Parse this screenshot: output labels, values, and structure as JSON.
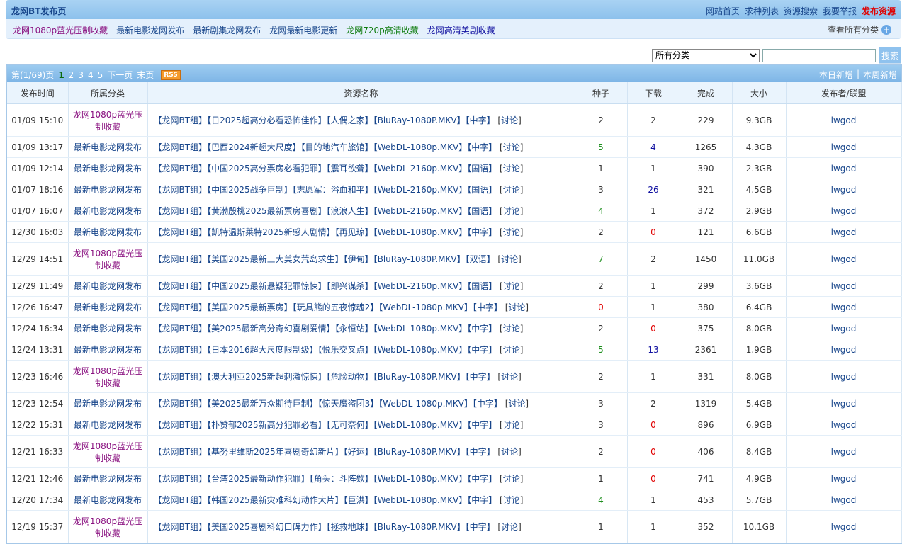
{
  "header": {
    "site_title": "龙网BT发布页",
    "nav": [
      {
        "label": "网站首页"
      },
      {
        "label": "求种列表"
      },
      {
        "label": "资源搜索"
      },
      {
        "label": "我要举报"
      },
      {
        "label": "发布资源"
      }
    ]
  },
  "categories": {
    "links": [
      {
        "label": "龙网1080p蓝光压制收藏",
        "color": "#8a1180"
      },
      {
        "label": "最新电影龙网发布",
        "color": "#16448a"
      },
      {
        "label": "最新剧集龙网发布",
        "color": "#16448a"
      },
      {
        "label": "龙网最新电影更新",
        "color": "#16448a"
      },
      {
        "label": "龙网720p高清收藏",
        "color": "#0b7a0b"
      },
      {
        "label": "龙网高清美剧收藏",
        "color": "#1010a0"
      }
    ],
    "view_all_label": "查看所有分类"
  },
  "search": {
    "select_value": "所有分类",
    "input_value": "",
    "button_label": "搜索"
  },
  "pager": {
    "info": "第(1/69)页",
    "current": "1",
    "pages": [
      "2",
      "3",
      "4",
      "5"
    ],
    "next": "下一页",
    "last": "末页",
    "rss": "RSS",
    "today": "本日新增",
    "separator": "|",
    "week": "本周新增"
  },
  "table": {
    "headers": [
      "发布时间",
      "所属分类",
      "资源名称",
      "种子",
      "下载",
      "完成",
      "大小",
      "发布者/联盟"
    ],
    "discuss_label": "讨论",
    "rows": [
      {
        "time": "01/09 15:10",
        "cat": "龙网1080p蓝光压制收藏",
        "title": "【龙网BT组】【日2025超高分必看恐怖佳作】【人偶之家】【BluRay-1080P.MKV】【中字】",
        "seeds": "2",
        "dl": "2",
        "done": "229",
        "size": "9.3GB",
        "pub": "lwgod"
      },
      {
        "time": "01/09 13:17",
        "cat": "最新电影龙网发布",
        "title": "【龙网BT组】【巴西2024新超大尺度】【目的地汽车旅馆】【WebDL-1080p.MKV】【中字】",
        "seeds": "5",
        "dl": "4",
        "done": "1265",
        "size": "4.3GB",
        "pub": "lwgod"
      },
      {
        "time": "01/09 12:14",
        "cat": "最新电影龙网发布",
        "title": "【龙网BT组】【中国2025高分票房必看犯罪】【震耳欲聋】【WebDL-2160p.MKV】【国语】",
        "seeds": "1",
        "dl": "1",
        "done": "390",
        "size": "2.3GB",
        "pub": "lwgod"
      },
      {
        "time": "01/07 18:16",
        "cat": "最新电影龙网发布",
        "title": "【龙网BT组】【中国2025战争巨制】【志愿军：浴血和平】【WebDL-2160p.MKV】【国语】",
        "seeds": "3",
        "dl": "26",
        "done": "321",
        "size": "4.5GB",
        "pub": "lwgod"
      },
      {
        "time": "01/07 16:07",
        "cat": "最新电影龙网发布",
        "title": "【龙网BT组】【黄渤殷桃2025最新票房喜剧】【浪浪人生】【WebDL-2160p.MKV】【国语】",
        "seeds": "4",
        "dl": "1",
        "done": "372",
        "size": "2.9GB",
        "pub": "lwgod"
      },
      {
        "time": "12/30 16:03",
        "cat": "最新电影龙网发布",
        "title": "【龙网BT组】【凯特温斯莱特2025新感人剧情】【再见琼】【WebDL-1080p.MKV】【中字】",
        "seeds": "2",
        "dl": "0",
        "done": "121",
        "size": "6.6GB",
        "pub": "lwgod"
      },
      {
        "time": "12/29 14:51",
        "cat": "龙网1080p蓝光压制收藏",
        "title": "【龙网BT组】【美国2025最新三大美女荒岛求生】【伊甸】【BluRay-1080P.MKV】【双语】",
        "seeds": "7",
        "dl": "2",
        "done": "1450",
        "size": "11.0GB",
        "pub": "lwgod"
      },
      {
        "time": "12/29 11:49",
        "cat": "最新电影龙网发布",
        "title": "【龙网BT组】【中国2025最新悬疑犯罪惊悚】【即兴谋杀】【WebDL-2160p.MKV】【国语】",
        "seeds": "2",
        "dl": "1",
        "done": "299",
        "size": "3.6GB",
        "pub": "lwgod"
      },
      {
        "time": "12/26 16:47",
        "cat": "最新电影龙网发布",
        "title": "【龙网BT组】【美国2025最新票房】【玩具熊的五夜惊魂2】【WebDL-1080p.MKV】【中字】",
        "seeds": "0",
        "dl": "1",
        "done": "380",
        "size": "6.4GB",
        "pub": "lwgod"
      },
      {
        "time": "12/24 16:34",
        "cat": "最新电影龙网发布",
        "title": "【龙网BT组】【美2025最新高分奇幻喜剧爱情】【永恒站】【WebDL-1080p.MKV】【中字】",
        "seeds": "2",
        "dl": "0",
        "done": "375",
        "size": "8.0GB",
        "pub": "lwgod"
      },
      {
        "time": "12/24 13:31",
        "cat": "最新电影龙网发布",
        "title": "【龙网BT组】【日本2016超大尺度限制级】【悦乐交叉点】【WebDL-1080p.MKV】【中字】",
        "seeds": "5",
        "dl": "13",
        "done": "2361",
        "size": "1.9GB",
        "pub": "lwgod"
      },
      {
        "time": "12/23 16:46",
        "cat": "龙网1080p蓝光压制收藏",
        "title": "【龙网BT组】【澳大利亚2025新超刺激惊悚】【危险动物】【BluRay-1080P.MKV】【中字】",
        "seeds": "2",
        "dl": "1",
        "done": "331",
        "size": "8.0GB",
        "pub": "lwgod"
      },
      {
        "time": "12/23 12:54",
        "cat": "最新电影龙网发布",
        "title": "【龙网BT组】【美2025最新万众期待巨制】【惊天魔盗团3】【WebDL-1080p.MKV】【中字】",
        "seeds": "3",
        "dl": "2",
        "done": "1319",
        "size": "5.4GB",
        "pub": "lwgod"
      },
      {
        "time": "12/22 15:31",
        "cat": "最新电影龙网发布",
        "title": "【龙网BT组】【朴赞郁2025新高分犯罪必看】【无可奈何】【WebDL-1080p.MKV】【中字】",
        "seeds": "3",
        "dl": "0",
        "done": "896",
        "size": "6.9GB",
        "pub": "lwgod"
      },
      {
        "time": "12/21 16:33",
        "cat": "龙网1080p蓝光压制收藏",
        "title": "【龙网BT组】【基努里维斯2025年喜剧奇幻新片】【好运】【BluRay-1080P.MKV】【中字】",
        "seeds": "2",
        "dl": "0",
        "done": "406",
        "size": "8.4GB",
        "pub": "lwgod"
      },
      {
        "time": "12/21 12:46",
        "cat": "最新电影龙网发布",
        "title": "【龙网BT组】【台湾2025最新动作犯罪】【角头：斗阵欸】【WebDL-1080p.MKV】【中字】",
        "seeds": "1",
        "dl": "0",
        "done": "741",
        "size": "4.9GB",
        "pub": "lwgod"
      },
      {
        "time": "12/20 17:34",
        "cat": "最新电影龙网发布",
        "title": "【龙网BT组】【韩国2025最新灾难科幻动作大片】【巨洪】【WebDL-1080p.MKV】【中字】",
        "seeds": "4",
        "dl": "1",
        "done": "453",
        "size": "5.7GB",
        "pub": "lwgod"
      },
      {
        "time": "12/19 15:37",
        "cat": "龙网1080p蓝光压制收藏",
        "title": "【龙网BT组】【美国2025喜剧科幻口碑力作】【拯救地球】【BluRay-1080P.MKV】【中字】",
        "seeds": "1",
        "dl": "1",
        "done": "352",
        "size": "10.1GB",
        "pub": "lwgod"
      }
    ]
  }
}
